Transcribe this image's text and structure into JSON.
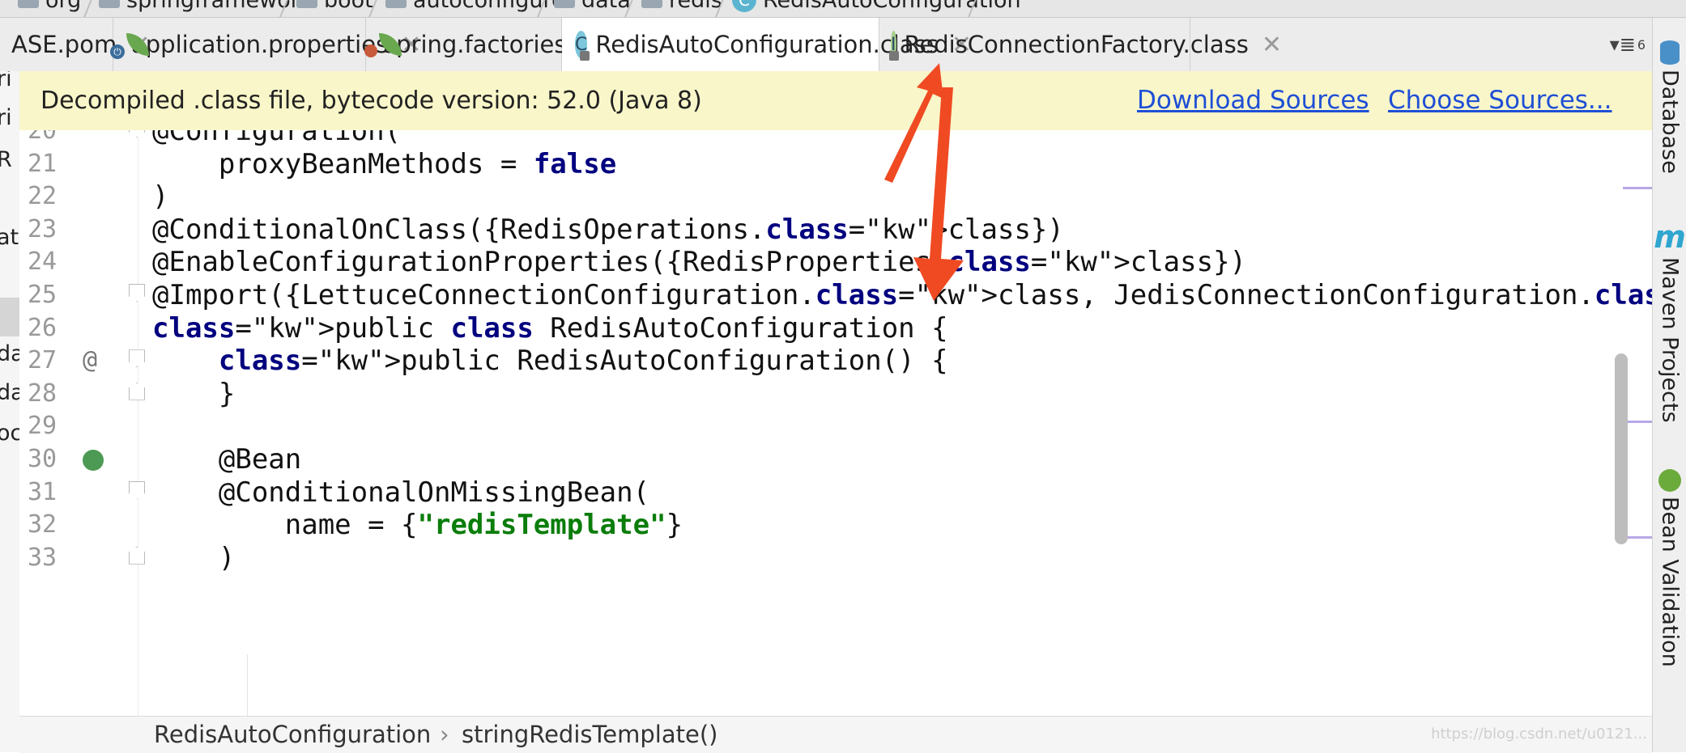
{
  "nav_breadcrumb": [
    {
      "label": "org",
      "icon": "folder-icon"
    },
    {
      "label": "springframework",
      "icon": "folder-icon"
    },
    {
      "label": "boot",
      "icon": "folder-icon"
    },
    {
      "label": "autoconfigure",
      "icon": "folder-icon"
    },
    {
      "label": "data",
      "icon": "folder-icon"
    },
    {
      "label": "redis",
      "icon": "folder-icon"
    },
    {
      "label": "RedisAutoConfiguration",
      "icon": "class-icon",
      "icon_letter": "C"
    }
  ],
  "tabs": [
    {
      "label": "ASE.pom",
      "active": false
    },
    {
      "label": "application.properties",
      "active": false,
      "icon": "spring-properties-icon"
    },
    {
      "label": "spring.factories",
      "active": false,
      "icon": "spring-factories-icon"
    },
    {
      "label": "RedisAutoConfiguration.class",
      "active": true,
      "icon": "class-icon",
      "icon_letter": "C"
    },
    {
      "label": "RedisConnectionFactory.class",
      "active": false,
      "icon": "interface-icon",
      "icon_letter": "I"
    }
  ],
  "tab_overflow": {
    "label": "6",
    "icon": "tab-list-icon"
  },
  "left_strip_fragments": [
    "ri",
    "ri",
    "R",
    "ati",
    "da",
    "da",
    "oc"
  ],
  "banner": {
    "text": "Decompiled .class file, bytecode version: 52.0 (Java 8)",
    "download_sources": "Download Sources",
    "choose_sources": "Choose Sources..."
  },
  "code_lines": [
    {
      "num": "20",
      "text": "@Configuration("
    },
    {
      "num": "21",
      "text": "    proxyBeanMethods = false"
    },
    {
      "num": "22",
      "text": ")"
    },
    {
      "num": "23",
      "text": "@ConditionalOnClass({RedisOperations.class})"
    },
    {
      "num": "24",
      "text": "@EnableConfigurationProperties({RedisProperties.class})"
    },
    {
      "num": "25",
      "text": "@Import({LettuceConnectionConfiguration.class, JedisConnectionConfiguration.class})"
    },
    {
      "num": "26",
      "text": "public class RedisAutoConfiguration {"
    },
    {
      "num": "27",
      "text": "    public RedisAutoConfiguration() {",
      "gutter": "@"
    },
    {
      "num": "28",
      "text": "    }"
    },
    {
      "num": "29",
      "text": ""
    },
    {
      "num": "30",
      "text": "    @Bean",
      "gutter": "bean-navigate-icon"
    },
    {
      "num": "31",
      "text": "    @ConditionalOnMissingBean("
    },
    {
      "num": "32",
      "text": "        name = {\"redisTemplate\"}"
    },
    {
      "num": "33",
      "text": "    )"
    }
  ],
  "bottom_breadcrumb": {
    "class_name": "RedisAutoConfiguration",
    "separator": "›",
    "method": "stringRedisTemplate()"
  },
  "right_tools": [
    {
      "label": "Database",
      "icon": "database-icon"
    },
    {
      "label": "Maven Projects",
      "icon": "maven-icon"
    },
    {
      "label": "Bean Validation",
      "icon": "bean-validation-icon"
    }
  ],
  "watermark": "https://blog.csdn.net/u0121...",
  "colors": {
    "keyword": "#00007f",
    "string": "#0a7d0a",
    "banner_bg": "#f9f6c9",
    "link": "#1f4fd6",
    "annotation_arrow": "#f04a23"
  }
}
